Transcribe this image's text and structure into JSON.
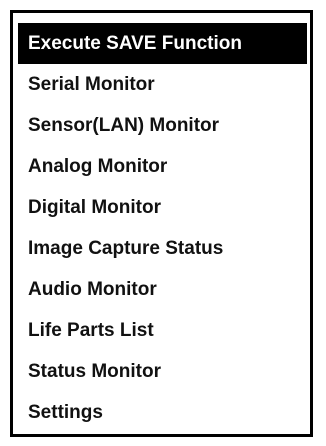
{
  "menu": {
    "items": [
      {
        "label": "Execute SAVE Function",
        "selected": true
      },
      {
        "label": "Serial Monitor",
        "selected": false
      },
      {
        "label": "Sensor(LAN) Monitor",
        "selected": false
      },
      {
        "label": "Analog Monitor",
        "selected": false
      },
      {
        "label": "Digital Monitor",
        "selected": false
      },
      {
        "label": "Image Capture Status",
        "selected": false
      },
      {
        "label": "Audio Monitor",
        "selected": false
      },
      {
        "label": "Life Parts List",
        "selected": false
      },
      {
        "label": "Status Monitor",
        "selected": false
      },
      {
        "label": "Settings",
        "selected": false
      }
    ]
  }
}
